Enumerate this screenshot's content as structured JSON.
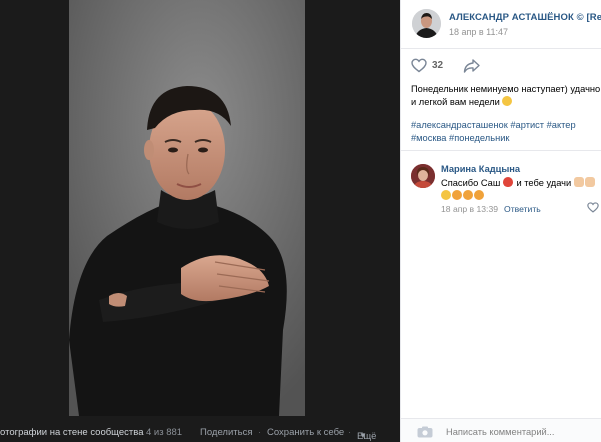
{
  "photo_bar": {
    "title": "отографии на стене сообщества",
    "counter": "4 из 881",
    "share": "Поделиться",
    "separator": "·",
    "save": "Сохранить к себе",
    "more": "Ещё"
  },
  "author": {
    "name": "АЛЕКСАНДР АСТАШЁНОК © [Real ...",
    "date": "18 апр в 11:47"
  },
  "actions": {
    "like_count": "32",
    "like_icon": "heart-outline-icon",
    "share_icon": "share-arrow-icon"
  },
  "post": {
    "line1": "Понедельник неминуемо наступает) удачно",
    "line2": "и легкой вам недели"
  },
  "tags": {
    "line1": "#александрасташенок #артист #актер",
    "line2": "#москва #понедельник"
  },
  "comment": {
    "author": "Марина Кадцына",
    "text1": "Спасибо Саш",
    "text1b": "и тебе удачи",
    "date": "18 апр в 13:39",
    "reply": "Ответить"
  },
  "comment_input": {
    "placeholder": "Написать комментарий..."
  },
  "colors": {
    "link": "#2a5885",
    "muted": "#939393",
    "viewer_bg": "#1b1b1b"
  }
}
